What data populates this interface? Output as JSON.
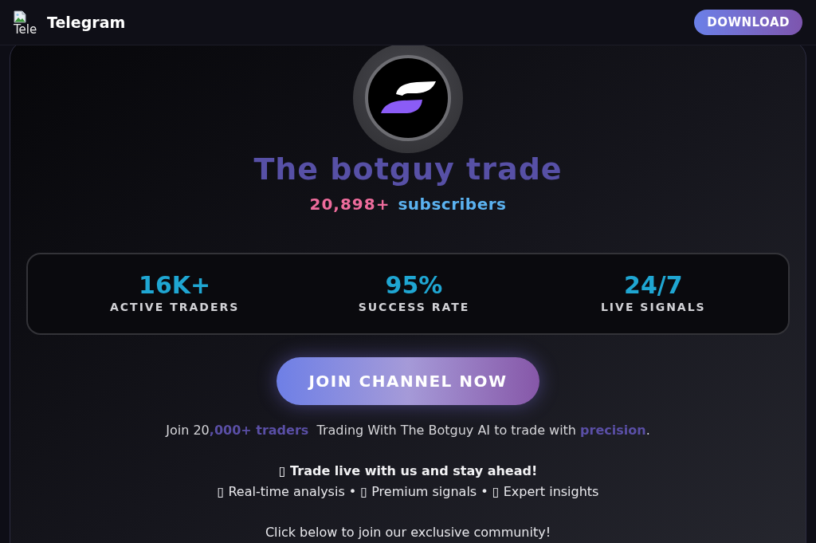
{
  "header": {
    "logo_alt": "Tele",
    "title": "Telegram",
    "download_button": "DOWNLOAD"
  },
  "channel": {
    "name": "The botguy trade",
    "subscriber_count": "20,898+",
    "subscriber_label": "subscribers"
  },
  "stats": [
    {
      "value": "16K+",
      "label": "ACTIVE TRADERS"
    },
    {
      "value": "95%",
      "label": "SUCCESS RATE"
    },
    {
      "value": "24/7",
      "label": "LIVE SIGNALS"
    }
  ],
  "join_button": "JOIN CHANNEL NOW",
  "description": "Join 20**,000+ traders**  Trading With The Botguy AI to trade with **precision**.",
  "tagline": "▯ Trade live with us and stay ahead!",
  "features": "▯ Real-time analysis • ▯ Premium signals • ▯ Expert insights",
  "cta_text": "Click below to join our exclusive community!"
}
